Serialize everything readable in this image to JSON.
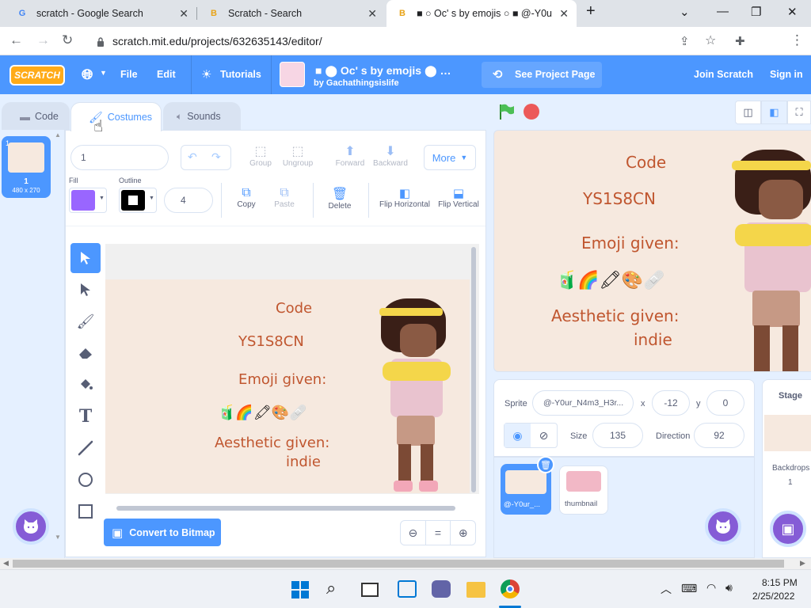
{
  "browser": {
    "tabs": [
      {
        "title": "scratch - Google Search",
        "favicon": "G"
      },
      {
        "title": "Scratch - Search",
        "favicon": "B"
      },
      {
        "title": "■ ○ Oc' s by emojis ○ ■ @-Y0u",
        "favicon": "B"
      }
    ],
    "new_tab": "+",
    "url": "scratch.mit.edu/projects/632635143/editor/"
  },
  "menubar": {
    "logo": "SCRATCH",
    "file": "File",
    "edit": "Edit",
    "tutorials": "Tutorials",
    "project_title": "■ ⬤ Oc' s by emojis ⬤ …",
    "project_author": "by Gachathingsislife",
    "see_project": "See Project Page",
    "join": "Join Scratch",
    "sign_in": "Sign in"
  },
  "tabs": {
    "code": "Code",
    "costumes": "Costumes",
    "sounds": "Sounds"
  },
  "costume_list": [
    {
      "index": "1",
      "name": "1",
      "size": "480 x 270"
    }
  ],
  "paint": {
    "costume_name": "1",
    "group": "Group",
    "ungroup": "Ungroup",
    "forward": "Forward",
    "backward": "Backward",
    "more": "More",
    "fill_label": "Fill",
    "outline_label": "Outline",
    "outline_width": "4",
    "copy": "Copy",
    "paste": "Paste",
    "delete": "Delete",
    "flip_h": "Flip Horizontal",
    "flip_v": "Flip Vertical",
    "convert": "Convert to Bitmap",
    "zoom_reset": "="
  },
  "costume_text": {
    "code_label": "Code",
    "code": "YS1S8CN",
    "emoji_label": "Emoji given:",
    "emojis": "🧃🌈🖍🎨🩹",
    "aesthetic_label": "Aesthetic given:",
    "aesthetic": "indie"
  },
  "sprite": {
    "label": "Sprite",
    "name": "@-Y0ur_N4m3_H3r...",
    "x_label": "x",
    "x": "-12",
    "y_label": "y",
    "y": "0",
    "size_label": "Size",
    "size": "135",
    "direction_label": "Direction",
    "direction": "92",
    "sprites": [
      {
        "name": "@-Y0ur_..."
      },
      {
        "name": "thumbnail"
      }
    ]
  },
  "stage_panel": {
    "title": "Stage",
    "backdrops_label": "Backdrops",
    "backdrops_count": "1"
  },
  "taskbar": {
    "time": "8:15 PM",
    "date": "2/25/2022"
  },
  "colors": {
    "scratch_blue": "#4c97ff",
    "fill": "#9966ff",
    "accent_text": "#c0562f",
    "purple": "#855cd6"
  }
}
